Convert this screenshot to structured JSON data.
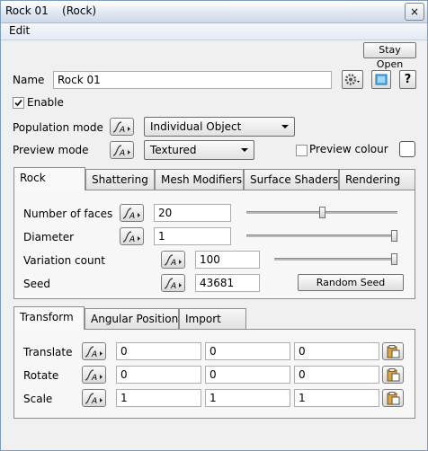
{
  "window": {
    "title": "Rock 01    (Rock)",
    "close_glyph": "×"
  },
  "menu": {
    "items": [
      "Edit"
    ]
  },
  "stay_open_label": "Stay Open",
  "name": {
    "label": "Name",
    "value": "Rock 01"
  },
  "enable": {
    "label": "Enable",
    "checked": true
  },
  "population_mode": {
    "label": "Population mode",
    "value": "Individual Object"
  },
  "preview_mode": {
    "label": "Preview mode",
    "value": "Textured"
  },
  "preview_colour": {
    "label": "Preview colour",
    "checked": false
  },
  "tabs": [
    "Rock",
    "Shattering",
    "Mesh Modifiers",
    "Surface Shaders",
    "Rendering"
  ],
  "active_tab": "Rock",
  "rock": {
    "number_of_faces": {
      "label": "Number of faces",
      "value": "20",
      "slider_fraction": 0.5
    },
    "diameter": {
      "label": "Diameter",
      "value": "1",
      "slider_fraction": 1.0
    },
    "variation_count": {
      "label": "Variation count",
      "value": "100",
      "slider_fraction": 1.0
    },
    "seed": {
      "label": "Seed",
      "value": "43681"
    },
    "random_seed_label": "Random Seed"
  },
  "lower_tabs": [
    "Transform",
    "Angular Position",
    "Import"
  ],
  "active_lower_tab": "Transform",
  "transform": {
    "translate": {
      "label": "Translate",
      "values": [
        "0",
        "0",
        "0"
      ]
    },
    "rotate": {
      "label": "Rotate",
      "values": [
        "0",
        "0",
        "0"
      ]
    },
    "scale": {
      "label": "Scale",
      "values": [
        "1",
        "1",
        "1"
      ]
    }
  }
}
